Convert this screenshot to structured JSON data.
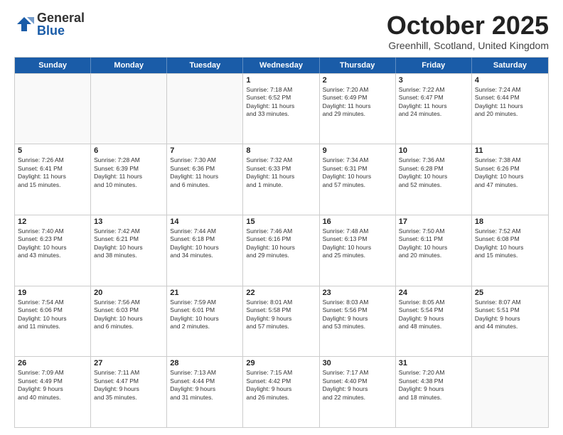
{
  "logo": {
    "general": "General",
    "blue": "Blue"
  },
  "title": {
    "month": "October 2025",
    "location": "Greenhill, Scotland, United Kingdom"
  },
  "weekdays": [
    "Sunday",
    "Monday",
    "Tuesday",
    "Wednesday",
    "Thursday",
    "Friday",
    "Saturday"
  ],
  "rows": [
    [
      {
        "day": "",
        "info": ""
      },
      {
        "day": "",
        "info": ""
      },
      {
        "day": "",
        "info": ""
      },
      {
        "day": "1",
        "info": "Sunrise: 7:18 AM\nSunset: 6:52 PM\nDaylight: 11 hours\nand 33 minutes."
      },
      {
        "day": "2",
        "info": "Sunrise: 7:20 AM\nSunset: 6:49 PM\nDaylight: 11 hours\nand 29 minutes."
      },
      {
        "day": "3",
        "info": "Sunrise: 7:22 AM\nSunset: 6:47 PM\nDaylight: 11 hours\nand 24 minutes."
      },
      {
        "day": "4",
        "info": "Sunrise: 7:24 AM\nSunset: 6:44 PM\nDaylight: 11 hours\nand 20 minutes."
      }
    ],
    [
      {
        "day": "5",
        "info": "Sunrise: 7:26 AM\nSunset: 6:41 PM\nDaylight: 11 hours\nand 15 minutes."
      },
      {
        "day": "6",
        "info": "Sunrise: 7:28 AM\nSunset: 6:39 PM\nDaylight: 11 hours\nand 10 minutes."
      },
      {
        "day": "7",
        "info": "Sunrise: 7:30 AM\nSunset: 6:36 PM\nDaylight: 11 hours\nand 6 minutes."
      },
      {
        "day": "8",
        "info": "Sunrise: 7:32 AM\nSunset: 6:33 PM\nDaylight: 11 hours\nand 1 minute."
      },
      {
        "day": "9",
        "info": "Sunrise: 7:34 AM\nSunset: 6:31 PM\nDaylight: 10 hours\nand 57 minutes."
      },
      {
        "day": "10",
        "info": "Sunrise: 7:36 AM\nSunset: 6:28 PM\nDaylight: 10 hours\nand 52 minutes."
      },
      {
        "day": "11",
        "info": "Sunrise: 7:38 AM\nSunset: 6:26 PM\nDaylight: 10 hours\nand 47 minutes."
      }
    ],
    [
      {
        "day": "12",
        "info": "Sunrise: 7:40 AM\nSunset: 6:23 PM\nDaylight: 10 hours\nand 43 minutes."
      },
      {
        "day": "13",
        "info": "Sunrise: 7:42 AM\nSunset: 6:21 PM\nDaylight: 10 hours\nand 38 minutes."
      },
      {
        "day": "14",
        "info": "Sunrise: 7:44 AM\nSunset: 6:18 PM\nDaylight: 10 hours\nand 34 minutes."
      },
      {
        "day": "15",
        "info": "Sunrise: 7:46 AM\nSunset: 6:16 PM\nDaylight: 10 hours\nand 29 minutes."
      },
      {
        "day": "16",
        "info": "Sunrise: 7:48 AM\nSunset: 6:13 PM\nDaylight: 10 hours\nand 25 minutes."
      },
      {
        "day": "17",
        "info": "Sunrise: 7:50 AM\nSunset: 6:11 PM\nDaylight: 10 hours\nand 20 minutes."
      },
      {
        "day": "18",
        "info": "Sunrise: 7:52 AM\nSunset: 6:08 PM\nDaylight: 10 hours\nand 15 minutes."
      }
    ],
    [
      {
        "day": "19",
        "info": "Sunrise: 7:54 AM\nSunset: 6:06 PM\nDaylight: 10 hours\nand 11 minutes."
      },
      {
        "day": "20",
        "info": "Sunrise: 7:56 AM\nSunset: 6:03 PM\nDaylight: 10 hours\nand 6 minutes."
      },
      {
        "day": "21",
        "info": "Sunrise: 7:59 AM\nSunset: 6:01 PM\nDaylight: 10 hours\nand 2 minutes."
      },
      {
        "day": "22",
        "info": "Sunrise: 8:01 AM\nSunset: 5:58 PM\nDaylight: 9 hours\nand 57 minutes."
      },
      {
        "day": "23",
        "info": "Sunrise: 8:03 AM\nSunset: 5:56 PM\nDaylight: 9 hours\nand 53 minutes."
      },
      {
        "day": "24",
        "info": "Sunrise: 8:05 AM\nSunset: 5:54 PM\nDaylight: 9 hours\nand 48 minutes."
      },
      {
        "day": "25",
        "info": "Sunrise: 8:07 AM\nSunset: 5:51 PM\nDaylight: 9 hours\nand 44 minutes."
      }
    ],
    [
      {
        "day": "26",
        "info": "Sunrise: 7:09 AM\nSunset: 4:49 PM\nDaylight: 9 hours\nand 40 minutes."
      },
      {
        "day": "27",
        "info": "Sunrise: 7:11 AM\nSunset: 4:47 PM\nDaylight: 9 hours\nand 35 minutes."
      },
      {
        "day": "28",
        "info": "Sunrise: 7:13 AM\nSunset: 4:44 PM\nDaylight: 9 hours\nand 31 minutes."
      },
      {
        "day": "29",
        "info": "Sunrise: 7:15 AM\nSunset: 4:42 PM\nDaylight: 9 hours\nand 26 minutes."
      },
      {
        "day": "30",
        "info": "Sunrise: 7:17 AM\nSunset: 4:40 PM\nDaylight: 9 hours\nand 22 minutes."
      },
      {
        "day": "31",
        "info": "Sunrise: 7:20 AM\nSunset: 4:38 PM\nDaylight: 9 hours\nand 18 minutes."
      },
      {
        "day": "",
        "info": ""
      }
    ]
  ]
}
